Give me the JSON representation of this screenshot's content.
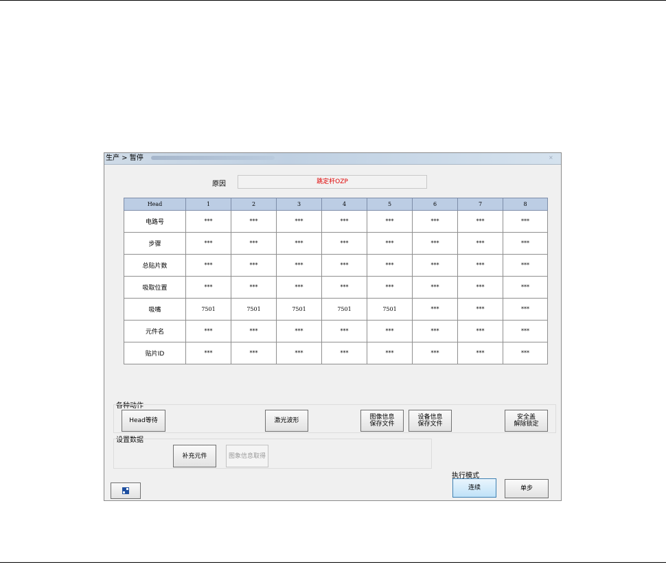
{
  "window": {
    "title": "生产 > 暂停",
    "close_glyph": "×"
  },
  "reason": {
    "label": "原因",
    "value": "跳定杆OZP",
    "value_color": "#e00000"
  },
  "table": {
    "headers": [
      "Head",
      "1",
      "2",
      "3",
      "4",
      "5",
      "6",
      "7",
      "8"
    ],
    "rows": [
      {
        "label": "电路号",
        "cells": [
          "***",
          "***",
          "***",
          "***",
          "***",
          "***",
          "***",
          "***"
        ]
      },
      {
        "label": "步骤",
        "cells": [
          "***",
          "***",
          "***",
          "***",
          "***",
          "***",
          "***",
          "***"
        ]
      },
      {
        "label": "总贴片数",
        "cells": [
          "***",
          "***",
          "***",
          "***",
          "***",
          "***",
          "***",
          "***"
        ]
      },
      {
        "label": "吸取位置",
        "cells": [
          "***",
          "***",
          "***",
          "***",
          "***",
          "***",
          "***",
          "***"
        ]
      },
      {
        "label": "吸嘴",
        "cells": [
          "7501",
          "7501",
          "7501",
          "7501",
          "7501",
          "***",
          "***",
          "***"
        ]
      },
      {
        "label": "元件名",
        "cells": [
          "***",
          "***",
          "***",
          "***",
          "***",
          "***",
          "***",
          "***"
        ]
      },
      {
        "label": "贴片ID",
        "cells": [
          "***",
          "***",
          "***",
          "***",
          "***",
          "***",
          "***",
          "***"
        ]
      }
    ]
  },
  "actions": {
    "section_label": "各种动作",
    "head_wait": "Head等待",
    "laser_wave": "激光波形",
    "image_save_l1": "图像信息",
    "image_save_l2": "保存文件",
    "device_save_l1": "设备信息",
    "device_save_l2": "保存文件",
    "safety_l1": "安全盖",
    "safety_l2": "解除锁定"
  },
  "setup": {
    "section_label": "设置数据",
    "supplement": "补充元件",
    "image_get": "图象信息取得"
  },
  "exec_mode": {
    "label": "执行模式",
    "continuous": "连续",
    "single_step": "单步"
  }
}
